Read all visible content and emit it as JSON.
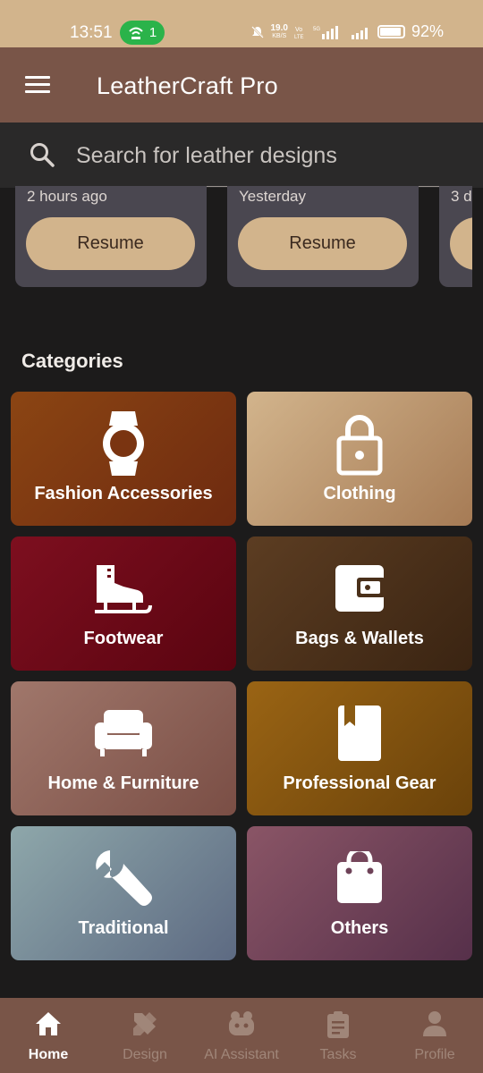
{
  "status": {
    "time": "13:51",
    "hotspot_count": "1",
    "net_speed_top": "19.0",
    "net_speed_bottom": "KB/S",
    "battery": "92%"
  },
  "appbar": {
    "title": "LeatherCraft Pro"
  },
  "search": {
    "placeholder": "Search for leather designs"
  },
  "recent": [
    {
      "when": "2 hours ago",
      "resume_label": "Resume"
    },
    {
      "when": "Yesterday",
      "resume_label": "Resume"
    },
    {
      "when": "3 d",
      "resume_label": ""
    }
  ],
  "categories_title": "Categories",
  "categories": [
    {
      "label": "Fashion Accessories",
      "icon": "watch-icon"
    },
    {
      "label": "Clothing",
      "icon": "lock-icon"
    },
    {
      "label": "Footwear",
      "icon": "ice-skate-icon"
    },
    {
      "label": "Bags & Wallets",
      "icon": "wallet-icon"
    },
    {
      "label": "Home & Furniture",
      "icon": "sofa-icon"
    },
    {
      "label": "Professional Gear",
      "icon": "book-bookmark-icon"
    },
    {
      "label": "Traditional",
      "icon": "wrench-icon"
    },
    {
      "label": "Others",
      "icon": "shopping-bag-icon"
    }
  ],
  "nav": [
    {
      "label": "Home",
      "icon": "home-icon",
      "active": true
    },
    {
      "label": "Design",
      "icon": "design-tools-icon",
      "active": false
    },
    {
      "label": "AI Assistant",
      "icon": "robot-icon",
      "active": false
    },
    {
      "label": "Tasks",
      "icon": "clipboard-icon",
      "active": false
    },
    {
      "label": "Profile",
      "icon": "person-icon",
      "active": false
    }
  ],
  "colors": {
    "appbar": "#795548",
    "statusbar": "#d2b48c",
    "accent": "#d2b48c",
    "background": "#1c1b1b"
  }
}
